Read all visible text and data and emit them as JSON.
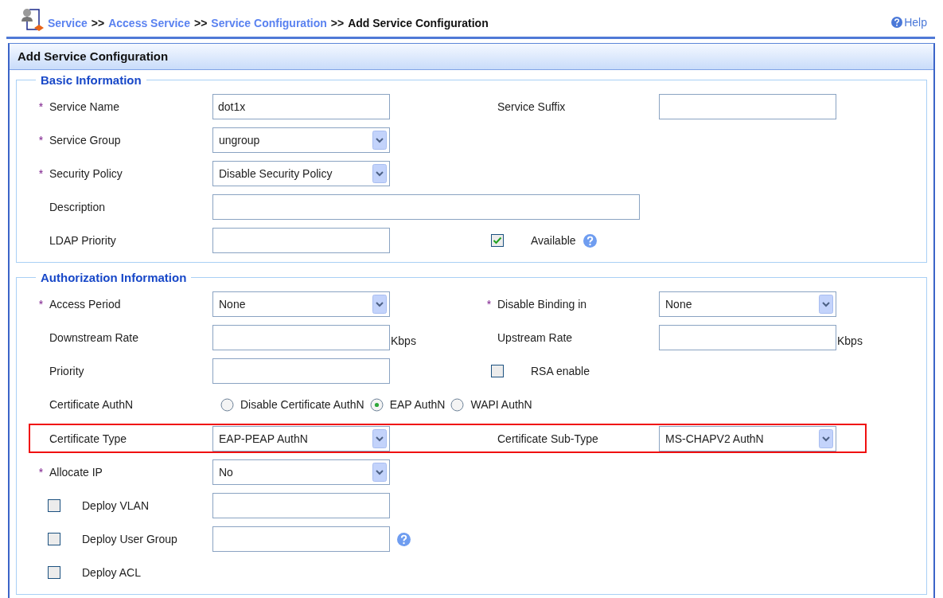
{
  "breadcrumb": [
    {
      "kind": "link",
      "text": "Service"
    },
    {
      "kind": "separator",
      "text": ">>"
    },
    {
      "kind": "link",
      "text": "Access Service"
    },
    {
      "kind": "separator",
      "text": ">>"
    },
    {
      "kind": "link",
      "text": "Service Configuration"
    },
    {
      "kind": "separator",
      "text": ">>"
    },
    {
      "kind": "current",
      "text": "Add Service Configuration"
    }
  ],
  "help": "Help",
  "panel_title": "Add Service Configuration",
  "sections": [
    {
      "title": "Basic Information",
      "rows": [
        {
          "cells": [
            {
              "kind": "text",
              "marker": "*",
              "label": "Service Name",
              "value": "dot1x"
            },
            {
              "kind": "text",
              "label": "Service Suffix"
            }
          ]
        },
        {
          "cells": [
            {
              "kind": "select",
              "marker": "*",
              "label": "Service Group",
              "value": "ungroup"
            }
          ]
        },
        {
          "cells": [
            {
              "kind": "select",
              "marker": "*",
              "label": "Security Policy",
              "value": "Disable Security Policy"
            }
          ]
        },
        {
          "cells": [
            {
              "kind": "long-text",
              "label": "Description"
            }
          ]
        },
        {
          "cells": [
            {
              "kind": "text",
              "label": "LDAP Priority"
            },
            {
              "kind": "checkbox",
              "checked": true,
              "label": "Available",
              "help": true
            }
          ]
        }
      ]
    },
    {
      "title": "Authorization Information",
      "rows": [
        {
          "cells": [
            {
              "kind": "select",
              "marker": "*",
              "label": "Access Period",
              "value": "None"
            },
            {
              "kind": "select",
              "marker": "*",
              "label": "Disable Binding in",
              "value": "None"
            }
          ]
        },
        {
          "cells": [
            {
              "kind": "text",
              "label": "Downstream Rate",
              "suffix": "Kbps"
            },
            {
              "kind": "text",
              "label": "Upstream Rate",
              "suffix": "Kbps"
            }
          ]
        },
        {
          "cells": [
            {
              "kind": "text",
              "label": "Priority"
            },
            {
              "kind": "checkbox",
              "checked": false,
              "label": "RSA enable"
            }
          ]
        },
        {
          "cells": [
            {
              "kind": "radio",
              "label": "Certificate AuthN",
              "options": [
                {
                  "label": "Disable Certificate AuthN",
                  "selected": false
                },
                {
                  "label": "EAP AuthN",
                  "selected": true
                },
                {
                  "label": "WAPI AuthN",
                  "selected": false
                }
              ]
            }
          ]
        },
        {
          "highlighted": true,
          "cells": [
            {
              "kind": "select",
              "label": "Certificate Type",
              "value": "EAP-PEAP AuthN"
            },
            {
              "kind": "select",
              "label": "Certificate Sub-Type",
              "value": "MS-CHAPV2 AuthN"
            }
          ]
        },
        {
          "cells": [
            {
              "kind": "select",
              "marker": "*",
              "label": "Allocate IP",
              "value": "No"
            }
          ]
        },
        {
          "cells": [
            {
              "kind": "check-field",
              "checked": false,
              "label": "Deploy VLAN",
              "input": true
            }
          ]
        },
        {
          "cells": [
            {
              "kind": "check-field",
              "checked": false,
              "label": "Deploy User Group",
              "input": true,
              "help": true
            }
          ]
        },
        {
          "cells": [
            {
              "kind": "check-field",
              "checked": false,
              "label": "Deploy ACL"
            }
          ]
        }
      ]
    }
  ]
}
